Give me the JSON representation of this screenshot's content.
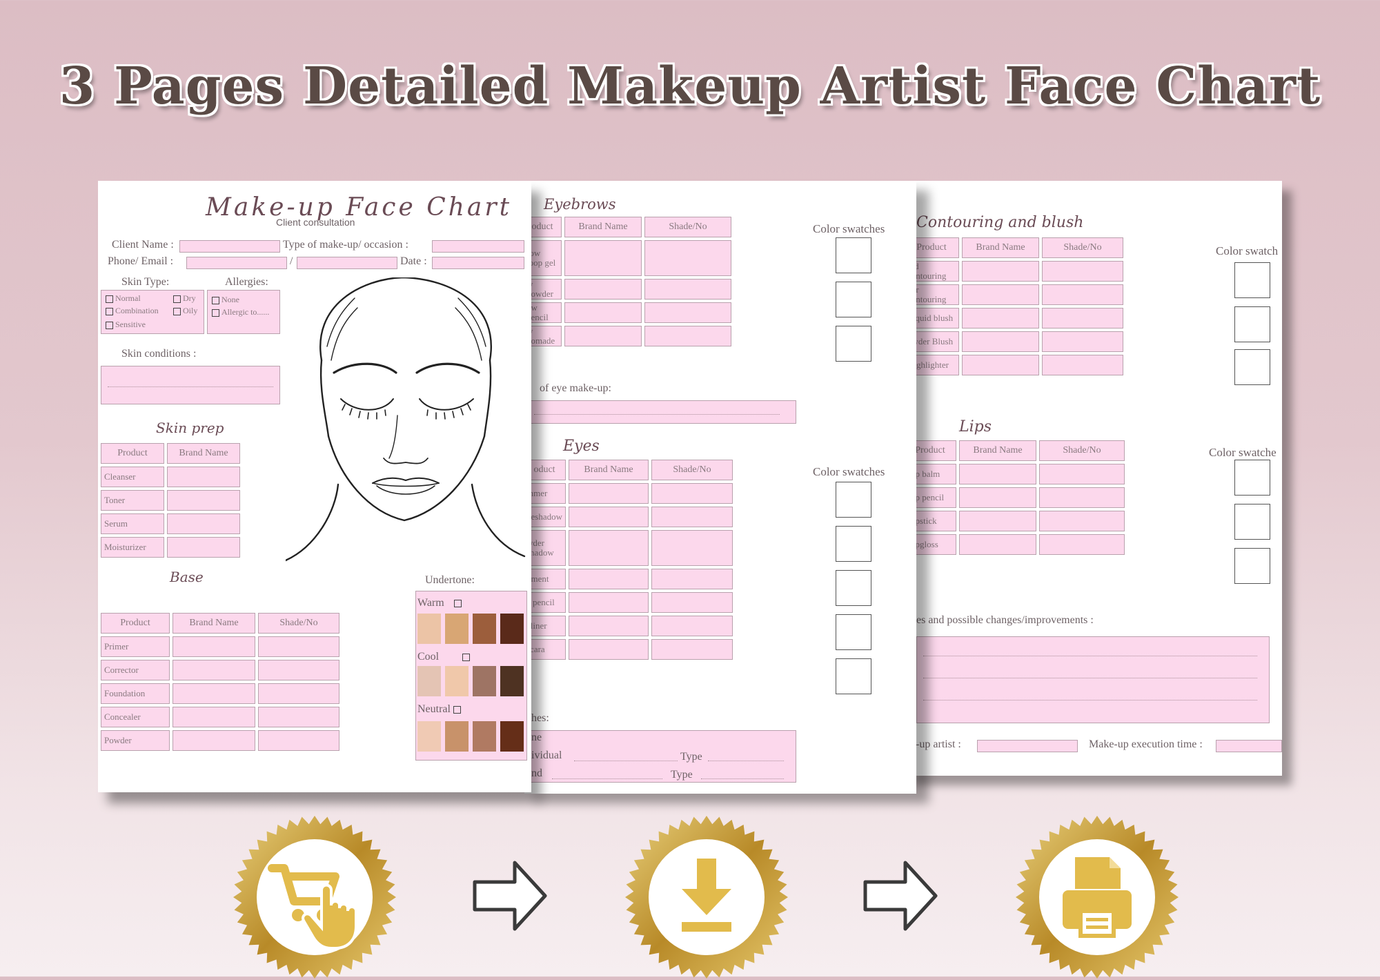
{
  "title": "3 Pages Detailed Makeup Artist Face Chart",
  "page1": {
    "heading": "Make-up Face Chart",
    "subheading": "Client consultation",
    "client_name": "Client Name :",
    "makeup_type": "Type of make-up/ occasion :",
    "phone_email": "Phone/ Email :",
    "slash": "/",
    "date": "Date :",
    "skin_type": "Skin Type:",
    "skin_options": [
      "Normal",
      "Dry",
      "Combination",
      "Oily",
      "Sensitive"
    ],
    "allergies": "Allergies:",
    "allergy_options": [
      "None",
      "Allergic to......"
    ],
    "skin_conditions": "Skin conditions :",
    "skin_prep": "Skin prep",
    "prep_headers": [
      "Product",
      "Brand Name"
    ],
    "prep_rows": [
      "Cleanser",
      "Toner",
      "Serum",
      "Moisturizer"
    ],
    "base": "Base",
    "base_headers": [
      "Product",
      "Brand Name",
      "Shade/No"
    ],
    "base_rows": [
      "Primer",
      "Corrector",
      "Foundation",
      "Concealer",
      "Powder"
    ],
    "undertone": "Undertone:",
    "undertone_groups": [
      "Warm",
      "Cool",
      "Neutral"
    ]
  },
  "page2": {
    "eyebrows": "Eyebrows",
    "headers": [
      "oduct",
      "Brand Name",
      "Shade/No"
    ],
    "brow_rows": [
      "row\nloop gel",
      "w powder",
      "ow pencil",
      "w pomade"
    ],
    "swatches_label": "Color swatches",
    "eye_makeup": "of eye make-up:",
    "eyes": "Eyes",
    "eyes_headers": [
      "oduct",
      "Brand Name",
      "Shade/No"
    ],
    "eye_rows": [
      "mmer",
      "yeshadow",
      "wder\nshadow",
      "gment",
      "e pencil",
      "eliner",
      "scara"
    ],
    "lashes": "hes:",
    "lash_lines": [
      "ne",
      "ividual",
      "nd"
    ],
    "type": "Type"
  },
  "page3": {
    "contouring": "Contouring and blush",
    "headers": [
      "Product",
      "Brand Name",
      "Shade/No"
    ],
    "contour_rows": [
      "uid contouring",
      "der contouring",
      "Liquid blush",
      "owder Blush",
      "Highlighter"
    ],
    "swatches_label": "Color swatch",
    "swatches_label2": "Color swatche",
    "lips": "Lips",
    "lip_rows": [
      "Lip balm",
      "Lip pencil",
      "Lipstick",
      "Lipgloss"
    ],
    "notes": "es and possible changes/improvements :",
    "artist": "e-up artist :",
    "execution": "Make-up execution time :"
  },
  "steps": [
    "shopping-cart-icon",
    "download-icon",
    "printer-icon"
  ],
  "colors": {
    "accent_pink": "#fcd8ec",
    "gold": "#c9a33a",
    "title": "#5a4a45"
  }
}
